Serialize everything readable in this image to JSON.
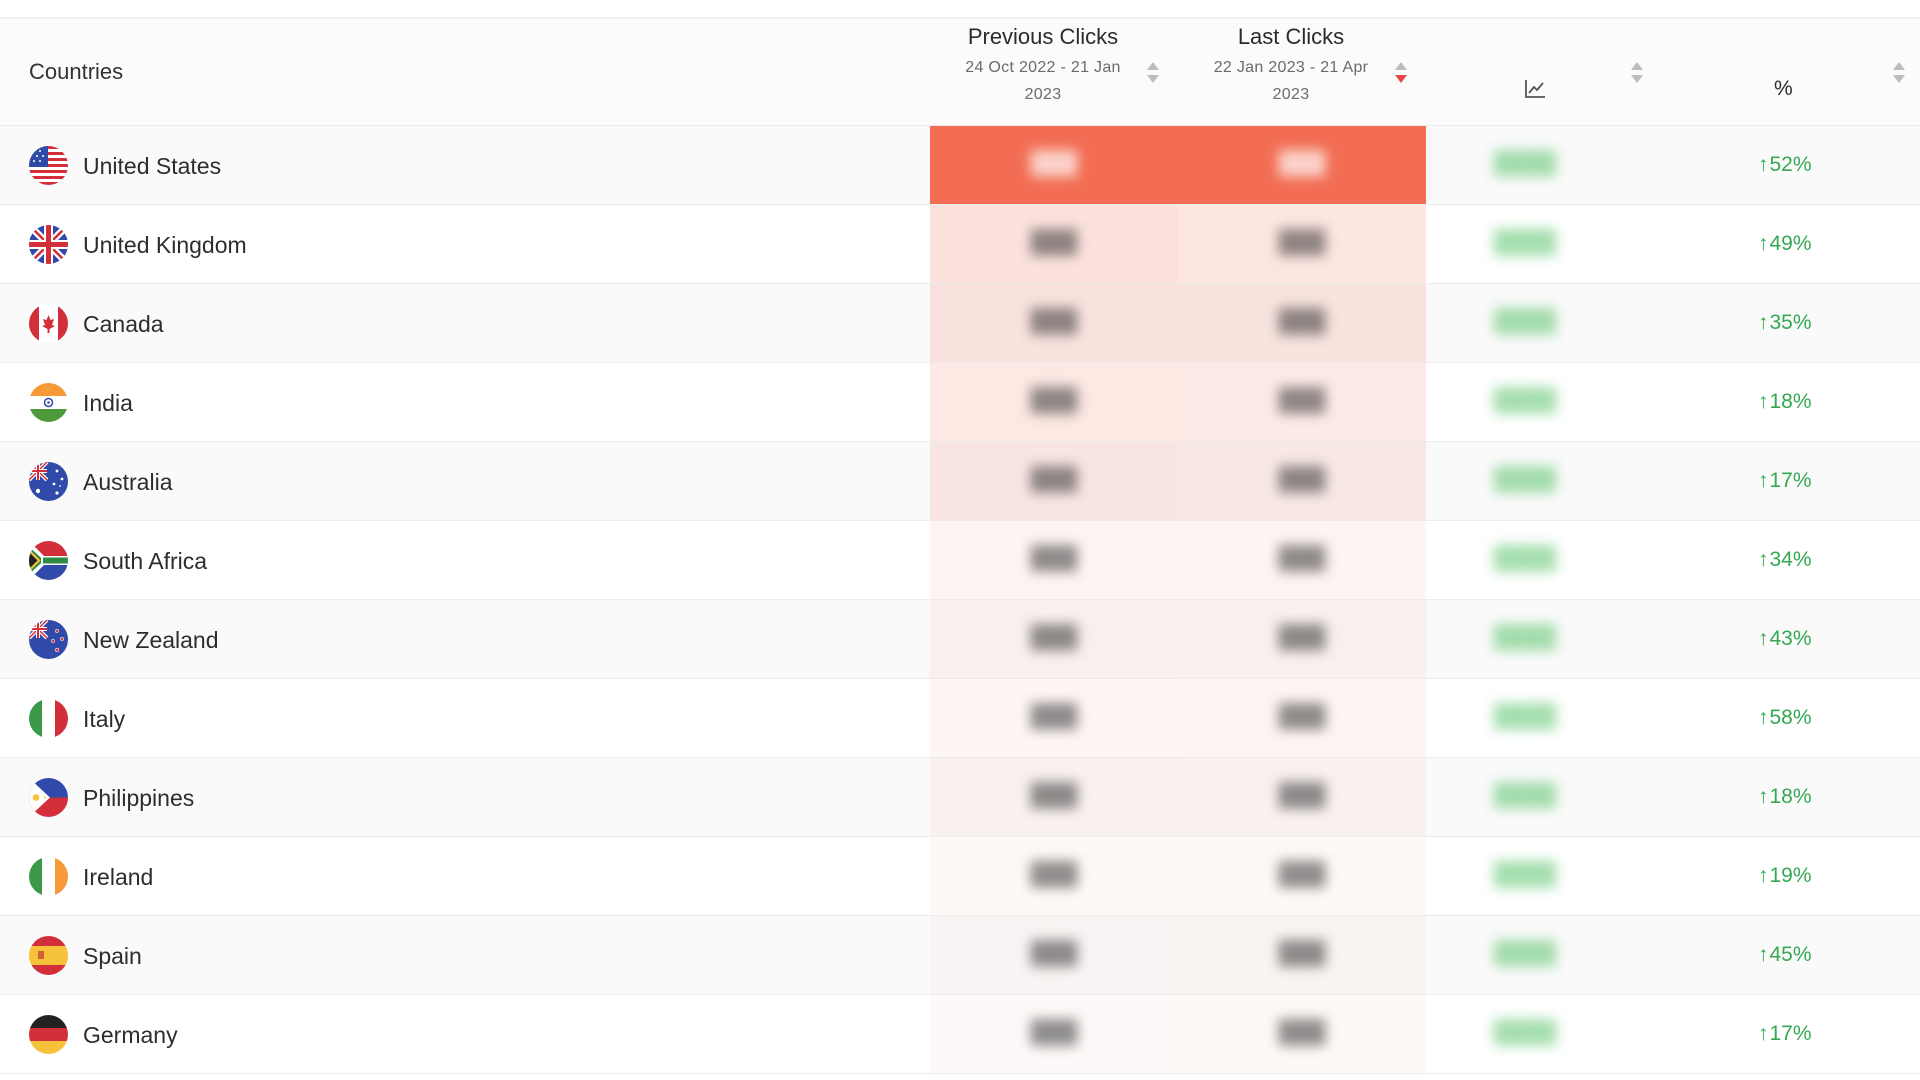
{
  "table": {
    "header": {
      "countries": "Countries",
      "previous": {
        "title": "Previous Clicks",
        "range_line1": "24 Oct 2022 - 21 Jan",
        "range_line2": "2023"
      },
      "last": {
        "title": "Last Clicks",
        "range_line1": "22 Jan 2023 - 21 Apr",
        "range_line2": "2023"
      },
      "trend_icon": "line-chart-icon",
      "percent": "%",
      "active_sort": "Last Clicks descending"
    },
    "rows": [
      {
        "country": "United States",
        "flag": "us-flag-icon",
        "pct": "52%",
        "direction": "up",
        "prev_shade": 1.0,
        "last_shade": 1.0
      },
      {
        "country": "United Kingdom",
        "flag": "uk-flag-icon",
        "pct": "49%",
        "direction": "up",
        "prev_shade": 0.2,
        "last_shade": 0.18
      },
      {
        "country": "Canada",
        "flag": "canada-flag-icon",
        "pct": "35%",
        "direction": "up",
        "prev_shade": 0.17,
        "last_shade": 0.16
      },
      {
        "country": "India",
        "flag": "india-flag-icon",
        "pct": "18%",
        "direction": "up",
        "prev_shade": 0.16,
        "last_shade": 0.14
      },
      {
        "country": "Australia",
        "flag": "australia-flag-icon",
        "pct": "17%",
        "direction": "up",
        "prev_shade": 0.14,
        "last_shade": 0.12
      },
      {
        "country": "South Africa",
        "flag": "south-africa-flag-icon",
        "pct": "34%",
        "direction": "up",
        "prev_shade": 0.07,
        "last_shade": 0.08
      },
      {
        "country": "New Zealand",
        "flag": "new-zealand-flag-icon",
        "pct": "43%",
        "direction": "up",
        "prev_shade": 0.07,
        "last_shade": 0.07
      },
      {
        "country": "Italy",
        "flag": "italy-flag-icon",
        "pct": "58%",
        "direction": "up",
        "prev_shade": 0.06,
        "last_shade": 0.07
      },
      {
        "country": "Philippines",
        "flag": "philippines-flag-icon",
        "pct": "18%",
        "direction": "up",
        "prev_shade": 0.06,
        "last_shade": 0.06
      },
      {
        "country": "Ireland",
        "flag": "ireland-flag-icon",
        "pct": "19%",
        "direction": "up",
        "prev_shade": 0.05,
        "last_shade": 0.05
      },
      {
        "country": "Spain",
        "flag": "spain-flag-icon",
        "pct": "45%",
        "direction": "up",
        "prev_shade": 0.04,
        "last_shade": 0.05
      },
      {
        "country": "Germany",
        "flag": "germany-flag-icon",
        "pct": "17%",
        "direction": "up",
        "prev_shade": 0.04,
        "last_shade": 0.05
      }
    ]
  },
  "colors": {
    "heat": "#f26d53",
    "positive": "#34a853",
    "sort_active": "#e8474c"
  }
}
